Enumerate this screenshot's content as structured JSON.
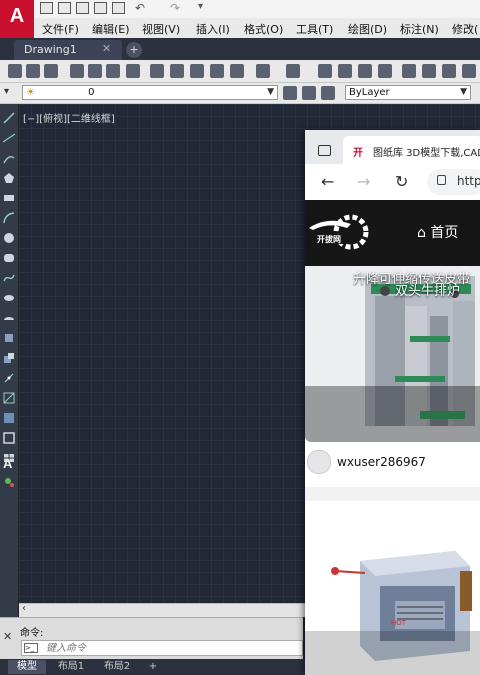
{
  "app": {
    "logo_letter": "A"
  },
  "menu": [
    "文件(F)",
    "编辑(E)",
    "视图(V)",
    "插入(I)",
    "格式(O)",
    "工具(T)",
    "绘图(D)",
    "标注(N)",
    "修改("
  ],
  "tabs": {
    "drawing": "Drawing1",
    "close": "✕",
    "add": "+"
  },
  "properties": {
    "layer_value": "0",
    "color_value": "ByLayer"
  },
  "viewport": {
    "label": "[−][俯视][二维线框]"
  },
  "command": {
    "label": "命令:",
    "placeholder": "键入命令",
    "close": "✕"
  },
  "layout_tabs": [
    "模型",
    "布局1",
    "布局2",
    "+"
  ],
  "browser": {
    "tab_title": "图纸库 3D模型下载,CAD",
    "favicon_text": "开",
    "url_partial": "http",
    "nav": {
      "back": "←",
      "forward": "→",
      "reload": "↻"
    },
    "site": {
      "logo_text": "开拔网",
      "home_link": "⌂ 首页",
      "card1_title": "升降可伸缩传送皮带",
      "author": "wxuser286967",
      "card2_title": "双头牛排炉",
      "card2_label": "HOT"
    }
  }
}
